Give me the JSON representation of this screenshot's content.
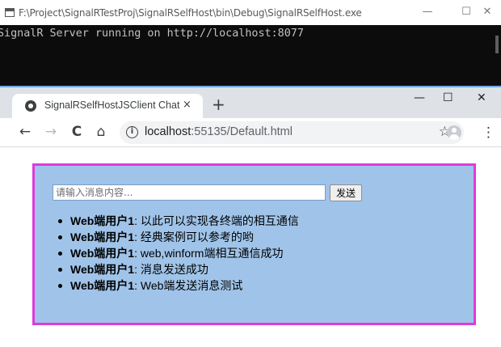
{
  "console": {
    "title": "F:\\Project\\SignalRTestProj\\SignalRSelfHost\\bin\\Debug\\SignalRSelfHost.exe",
    "output": "SignalR Server running on http://localhost:8077",
    "controls": {
      "minimize": "—",
      "maximize": "☐",
      "close": "✕"
    }
  },
  "browser": {
    "tab_title": "SignalRSelfHostJSClient Chat",
    "tab_close": "×",
    "new_tab": "+",
    "controls": {
      "minimize": "—",
      "maximize": "☐",
      "close": "✕"
    },
    "nav": {
      "back": "←",
      "forward": "→",
      "reload": "C",
      "home": "⌂"
    },
    "url_host": "localhost",
    "url_rest": ":55135/Default.html",
    "info_icon": "i",
    "star_icon": "☆",
    "menu_icon": "⋮"
  },
  "chat": {
    "input_placeholder": "请输入消息内容...",
    "send_label": "发送",
    "messages": [
      {
        "user": "Web端用户1",
        "sep": ": ",
        "text": "以此可以实现各终端的相互通信"
      },
      {
        "user": "Web端用户1",
        "sep": ": ",
        "text": "经典案例可以参考的哟"
      },
      {
        "user": "Web端用户1",
        "sep": ": ",
        "text": "web,winform端相互通信成功"
      },
      {
        "user": "Web端用户1",
        "sep": ": ",
        "text": "消息发送成功"
      },
      {
        "user": "Web端用户1",
        "sep": ": ",
        "text": "Web端发送消息测试"
      }
    ]
  },
  "colors": {
    "console_bg": "#0c0c0c",
    "chat_bg": "#a0c4e9",
    "chat_border": "#e03adb"
  }
}
